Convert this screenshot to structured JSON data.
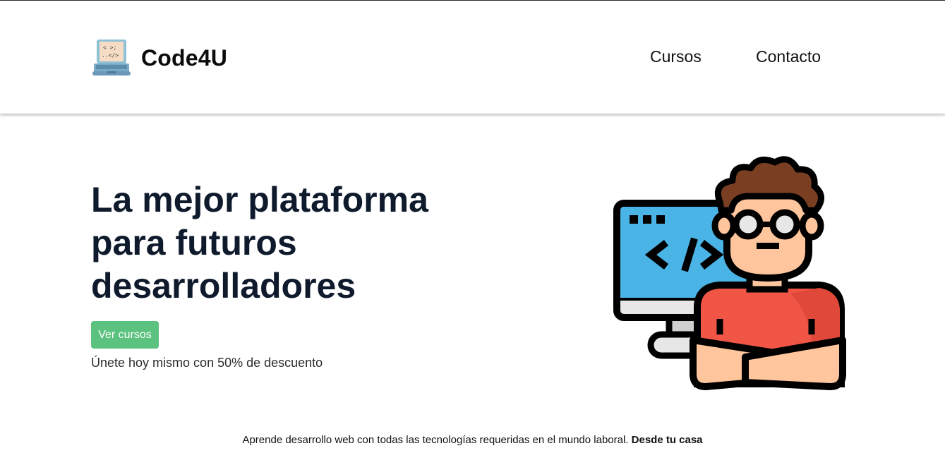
{
  "navbar": {
    "brand_name": "Code4U",
    "brand_logo_icon": "laptop-code-icon",
    "links": [
      "Cursos",
      "Contacto"
    ]
  },
  "hero": {
    "title": "La mejor plataforma para futuros desarrolladores",
    "cta_label": "Ver cursos",
    "subtitle": "Únete hoy mismo con 50% de descuento",
    "illustration_icon": "developer-at-computer-icon"
  },
  "footer": {
    "text": "Aprende desarrollo web con todas las tecnologías requeridas en el mundo laboral.",
    "emphasis": "Desde tu casa"
  },
  "colors": {
    "cta_background": "#5bc27f",
    "title_color": "#0f1b2d",
    "screen_blue": "#4ab4e6",
    "shirt_red": "#f05545",
    "hair_brown": "#7a3f22",
    "skin": "#ffc59c"
  }
}
